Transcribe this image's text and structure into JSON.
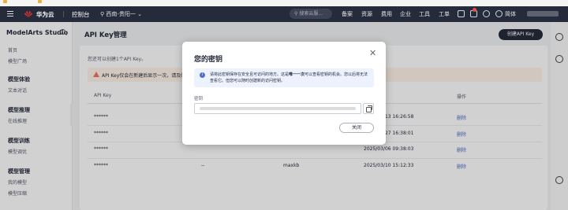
{
  "brand": {
    "name": "华为云",
    "console": "控制台",
    "region": "西南-贵阳一"
  },
  "topnav": {
    "search_placeholder": "搜索云服...",
    "items": [
      "备案",
      "资源",
      "费用",
      "企业",
      "工具",
      "工单"
    ],
    "lang": "简体"
  },
  "sidebar": {
    "title": "ModelArts Studio",
    "items": [
      {
        "label": "首页",
        "group": false
      },
      {
        "label": "模型广场",
        "group": false
      },
      {
        "label": "模型体验",
        "group": true
      },
      {
        "label": "文本对话",
        "group": false
      },
      {
        "label": "模型推理",
        "group": true
      },
      {
        "label": "在线推理",
        "group": false
      },
      {
        "label": "模型训练",
        "group": true
      },
      {
        "label": "模型调优",
        "group": false
      },
      {
        "label": "模型管理",
        "group": true
      },
      {
        "label": "我的模型",
        "group": false
      },
      {
        "label": "模型压缩",
        "group": false
      }
    ]
  },
  "main": {
    "title": "API Key管理",
    "create_button": "创建API Key",
    "hint": "您还可以创建1个API Key。",
    "warning": "API Key仅会在新建后显示一次，请及时",
    "columns": [
      "API Key",
      "",
      "",
      "",
      "操作"
    ],
    "rows": [
      {
        "key": "******",
        "desc": "",
        "name": "",
        "time": "2025/03/13 16:26:58",
        "action": "删除"
      },
      {
        "key": "******",
        "desc": "",
        "name": "",
        "time": "2025/02/27 16:38:01",
        "action": "删除"
      },
      {
        "key": "******",
        "desc": "",
        "name": "",
        "time": "2025/03/06 09:38:03",
        "action": "删除"
      },
      {
        "key": "******",
        "desc": "--",
        "name": "maxkb",
        "time": "2025/03/10 15:12:33",
        "action": "删除"
      }
    ]
  },
  "modal": {
    "title": "您的密钥",
    "info_pre": "请将此密钥保存在安全且可访问的地方。这是",
    "info_bold": "唯一一次",
    "info_post": "可以查看密钥的机会。您以后将无法查看它。但您可以随时创建新的访问密钥。",
    "label": "密钥",
    "close_button": "关闭"
  },
  "colors": {
    "accent": "#526ecc",
    "topbar": "#252b3a",
    "warning_bg": "#fff3e8"
  }
}
